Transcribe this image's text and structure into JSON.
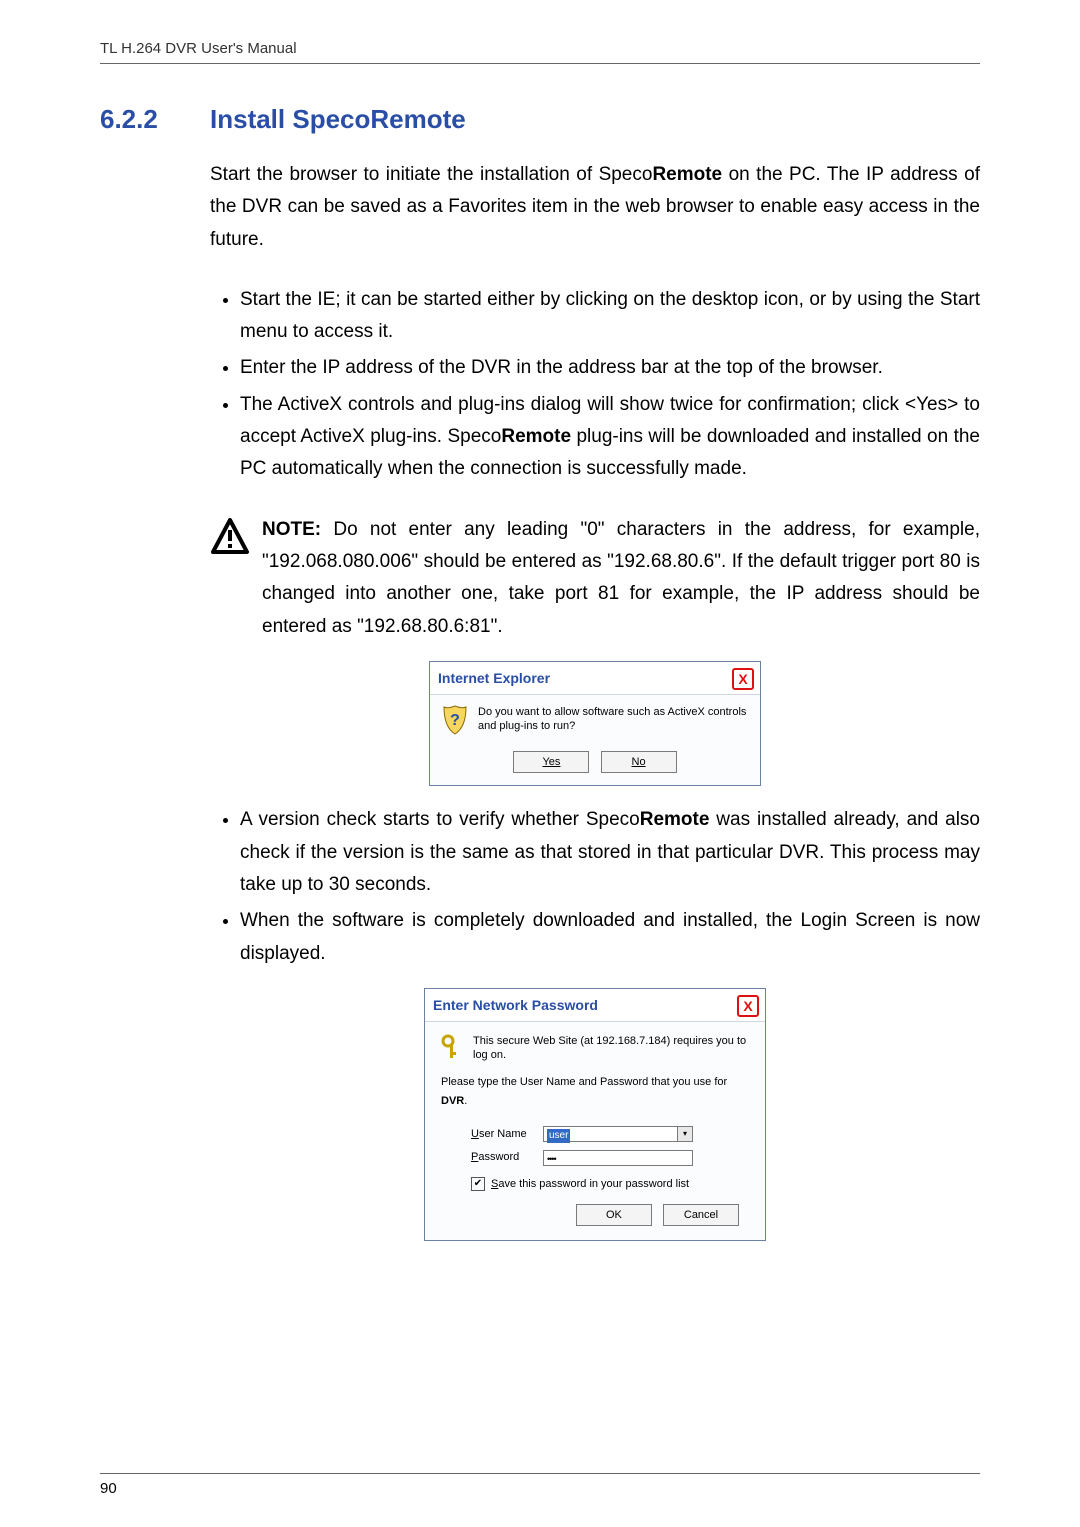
{
  "doc": {
    "header": "TL H.264 DVR User's Manual",
    "page_number": "90"
  },
  "heading": {
    "number": "6.2.2",
    "title": "Install SpecoRemote"
  },
  "intro": {
    "p1_a": "Start the browser to initiate the installation of Speco",
    "p1_b": "Remote",
    "p1_c": " on the PC. The IP address of the DVR can be saved as a Favorites item in the web browser to enable easy access in the future."
  },
  "bullets1": {
    "b1": "Start the IE; it can be started either by clicking on the desktop icon, or by using the Start menu to access it.",
    "b2": "Enter the IP address of the DVR in the address bar at the top of the browser.",
    "b3_a": "The ActiveX controls and plug-ins dialog will show twice for confirmation; click <Yes> to accept ActiveX plug-ins. Speco",
    "b3_b": "Remote",
    "b3_c": " plug-ins will be downloaded and installed on the PC automatically when the connection is successfully made."
  },
  "note": {
    "label": "NOTE:",
    "text": " Do not enter any leading \"0\" characters in the address, for example, \"192.068.080.006\" should be entered as \"192.68.80.6\". If the default trigger port 80 is changed into another one, take port 81 for example, the IP address should be entered as \"192.68.80.6:81\"."
  },
  "ie_dialog": {
    "title": "Internet Explorer",
    "message": "Do you want to allow software such as ActiveX controls and plug-ins to run?",
    "yes": "Yes",
    "no": "No",
    "close": "X"
  },
  "bullets2": {
    "b4_a": "A version check starts to verify whether Speco",
    "b4_b": "Remote",
    "b4_c": " was installed already, and also check if the version is the same as that stored in that particular DVR. This process may take up to 30 seconds.",
    "b5": "When the software is completely downloaded and installed, the Login Screen is now displayed."
  },
  "pw_dialog": {
    "title": "Enter Network Password",
    "msg1": "This secure Web Site (at 192.168.7.184) requires you to log on.",
    "msg2_a": "Please type the User Name and Password that you use for ",
    "msg2_b": "DVR",
    "msg2_c": ".",
    "username_label_u": "U",
    "username_label_rest": "ser Name",
    "username_value": "user",
    "password_label_u": "P",
    "password_label_rest": "assword",
    "password_value": "••••",
    "save_label_u": "S",
    "save_label_rest": "ave this password in your password list",
    "ok": "OK",
    "cancel": "Cancel",
    "close": "X"
  }
}
